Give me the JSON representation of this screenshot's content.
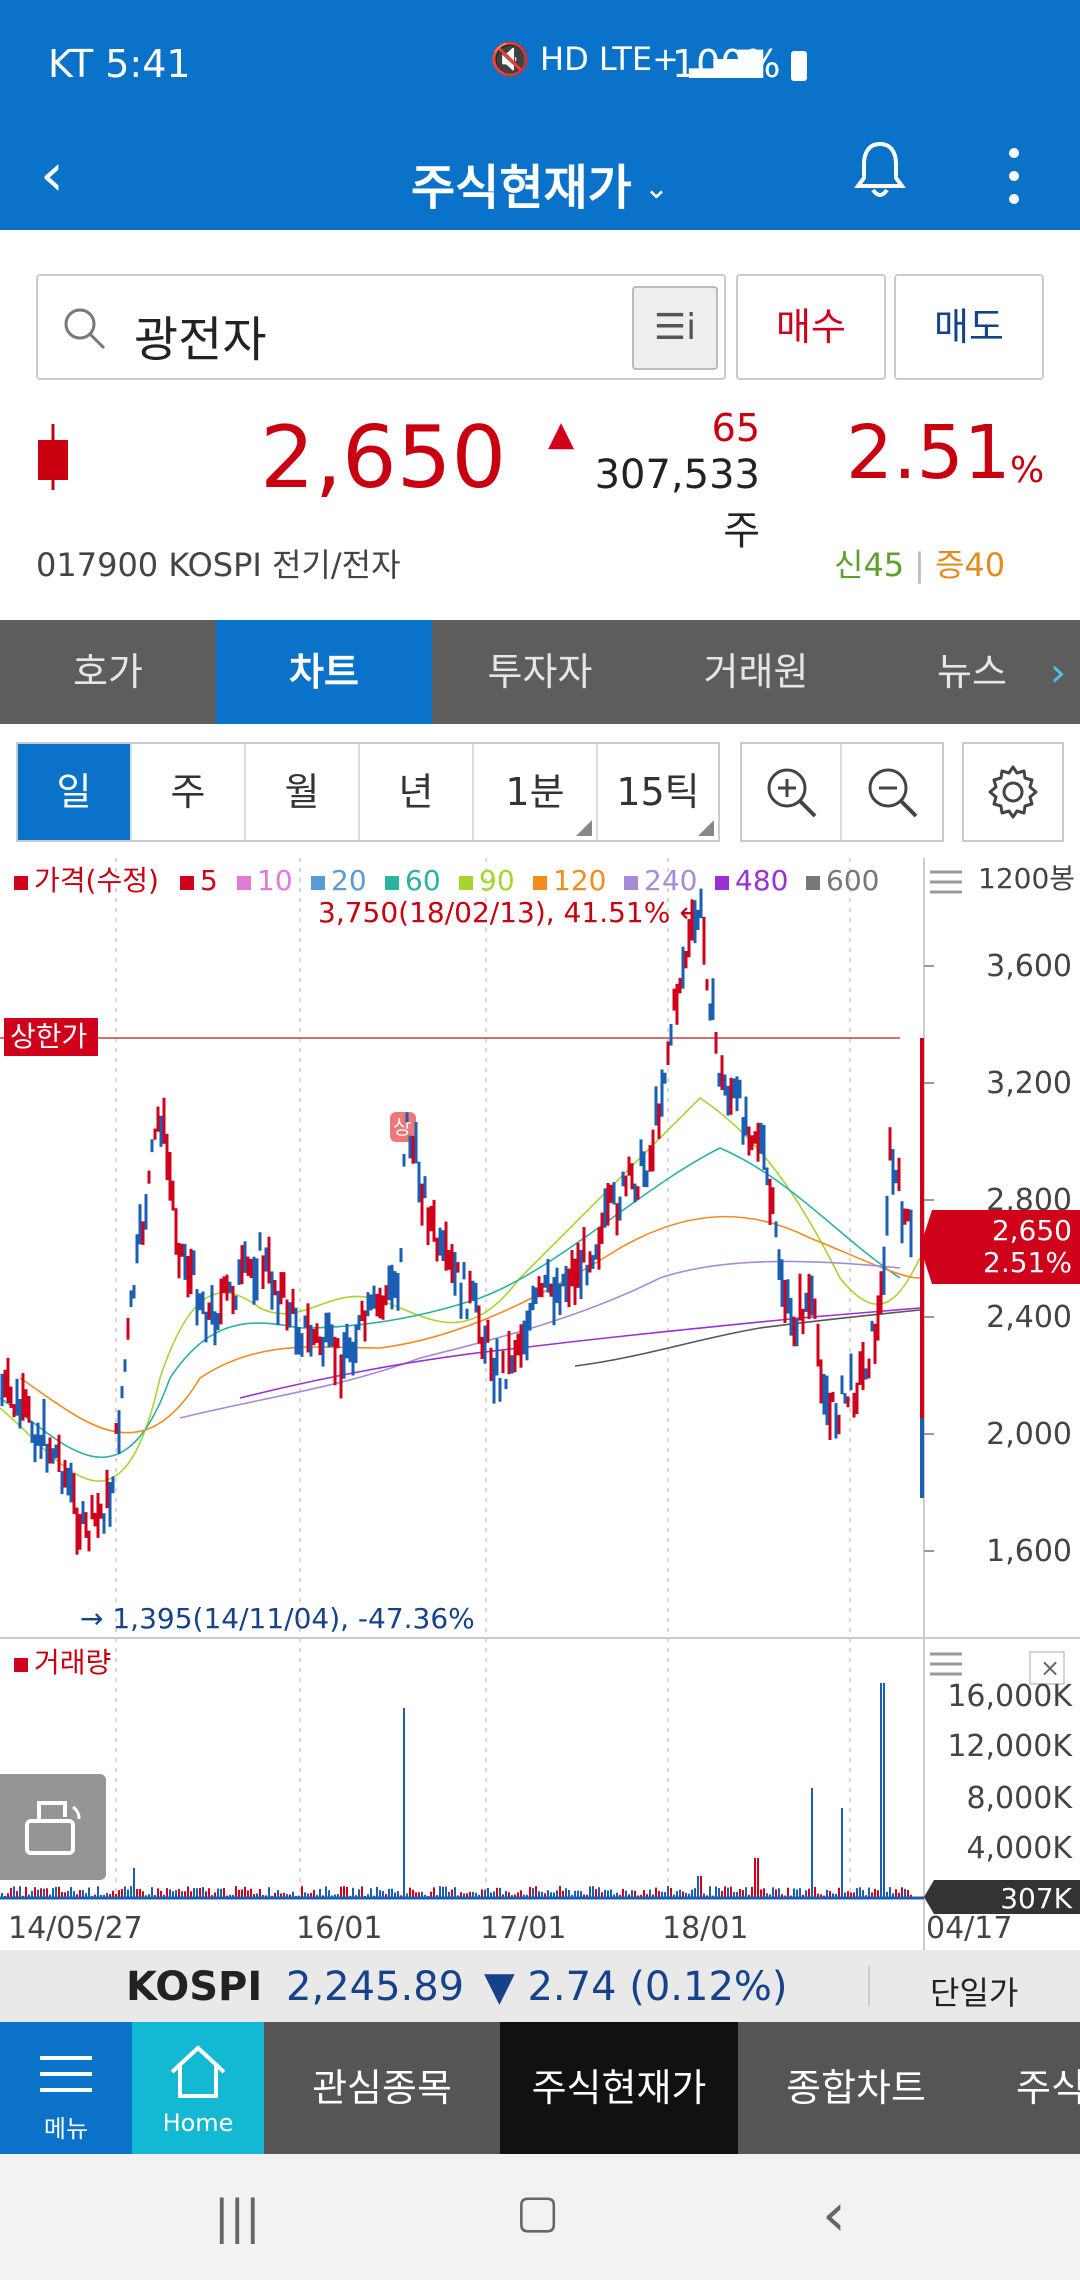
{
  "status_bar": {
    "carrier_time": "KT 5:41",
    "network": "HD LTE+",
    "battery": "100%"
  },
  "header": {
    "title": "주식현재가"
  },
  "search": {
    "value": "광전자"
  },
  "actions": {
    "buy": "매수",
    "sell": "매도"
  },
  "quote": {
    "price": "2,650",
    "change": "65",
    "volume": "307,533주",
    "rate": "2.51",
    "rate_unit": "%",
    "code_market_sector": "017900  KOSPI  전기/전자",
    "credit_new": "신45",
    "credit_margin": "증40",
    "up_color": "#d0021b"
  },
  "tabs": [
    "호가",
    "차트",
    "투자자",
    "거래원",
    "뉴스"
  ],
  "periods": [
    "일",
    "주",
    "월",
    "년",
    "1분",
    "15틱"
  ],
  "chart": {
    "legend_prefix": "가격(수정)",
    "legend_items": [
      {
        "label": "5",
        "color": "#d0021b"
      },
      {
        "label": "10",
        "color": "#e07bd6"
      },
      {
        "label": "20",
        "color": "#5b9bd5"
      },
      {
        "label": "60",
        "color": "#2bb3a0"
      },
      {
        "label": "90",
        "color": "#a6d530"
      },
      {
        "label": "120",
        "color": "#f58b1f"
      },
      {
        "label": "240",
        "color": "#a68bd9"
      },
      {
        "label": "480",
        "color": "#9a30d6"
      },
      {
        "label": "600",
        "color": "#777777"
      }
    ],
    "bong_count": "1200봉",
    "high_note": "3,750(18/02/13), 41.51% ←",
    "low_note": "→ 1,395(14/11/04), -47.36%",
    "upper_limit_label": "상한가",
    "upper_limit_marker": "상",
    "price_ticks": [
      "3,600",
      "3,200",
      "2,800",
      "2,400",
      "2,000",
      "1,600"
    ],
    "current_price_tag": "2,650",
    "current_rate_tag": "2.51%",
    "volume_label": "거래량",
    "volume_ticks": [
      "16,000K",
      "12,000K",
      "8,000K",
      "4,000K"
    ],
    "current_volume_tag": "307K",
    "x_ticks": [
      "14/05/27",
      "16/01",
      "17/01",
      "18/01",
      "04/17"
    ]
  },
  "index_bar": {
    "name": "KOSPI",
    "value": "2,245.89",
    "change": "▼ 2.74 (0.12%)",
    "single": "단일가"
  },
  "bottom_nav": {
    "menu": "메뉴",
    "home": "Home",
    "watchlist": "관심종목",
    "current": "주식현재가",
    "chart": "종합차트",
    "more": "주식"
  }
}
